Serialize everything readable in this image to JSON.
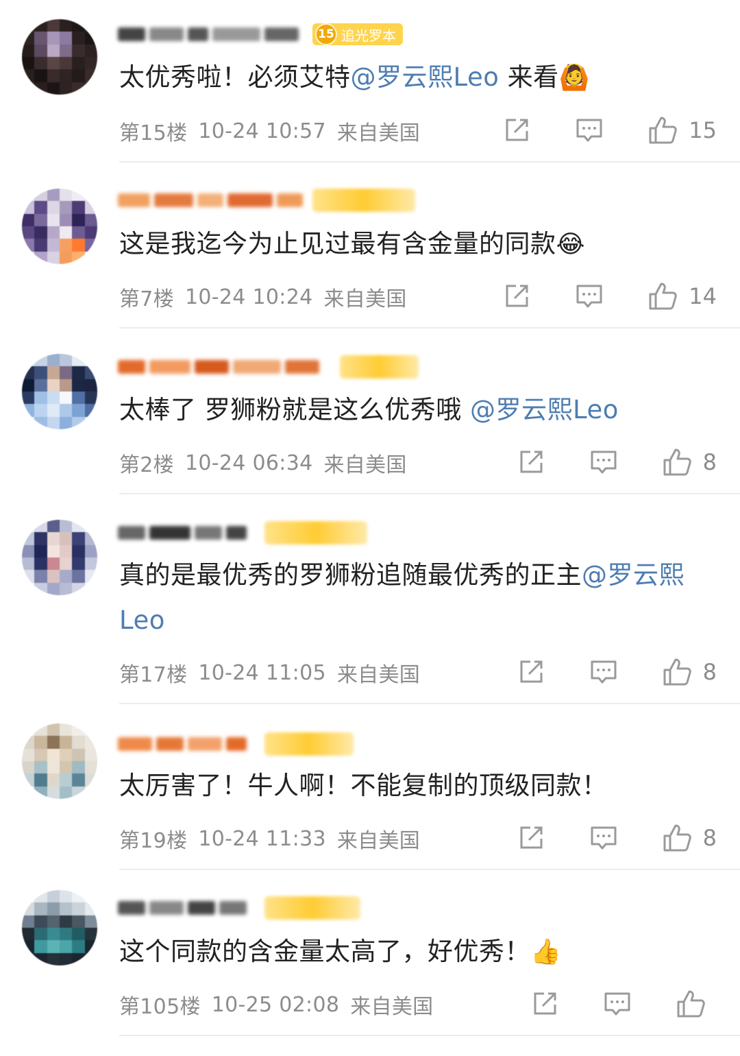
{
  "comments": [
    {
      "badge_level": "15",
      "badge_label": "追光罗本",
      "text_parts": [
        "太优秀啦！必须艾特",
        "@罗云熙Leo",
        " 来看",
        "🙆"
      ],
      "floor": "第15楼",
      "time": "10-24 10:57",
      "location": "来自美国",
      "likes": "15"
    },
    {
      "text_parts": [
        "这是我迄今为止见过最有含金量的同款",
        "😂"
      ],
      "floor": "第7楼",
      "time": "10-24 10:24",
      "location": "来自美国",
      "likes": "14"
    },
    {
      "text_parts": [
        "太棒了 罗狮粉就是这么优秀哦 ",
        "@罗云熙Leo"
      ],
      "floor": "第2楼",
      "time": "10-24 06:34",
      "location": "来自美国",
      "likes": "8"
    },
    {
      "text_parts": [
        "真的是最优秀的罗狮粉追随最优秀的正主",
        "@罗云熙Leo"
      ],
      "floor": "第17楼",
      "time": "10-24 11:05",
      "location": "来自美国",
      "likes": "8"
    },
    {
      "text_parts": [
        "太厉害了！牛人啊！不能复制的顶级同款！"
      ],
      "floor": "第19楼",
      "time": "10-24 11:33",
      "location": "来自美国",
      "likes": "8"
    },
    {
      "text_parts": [
        "这个同款的含金量太高了，好优秀！",
        "👍"
      ],
      "floor": "第105楼",
      "time": "10-25 02:08",
      "location": "来自美国",
      "likes": ""
    }
  ],
  "icons": {
    "share": "share-icon",
    "reply": "comment-icon",
    "like": "thumbs-up-icon"
  },
  "colors": {
    "mention": "#4e7db1",
    "meta": "#8c8c8c",
    "text": "#222222",
    "badge": "#ffd44d"
  }
}
